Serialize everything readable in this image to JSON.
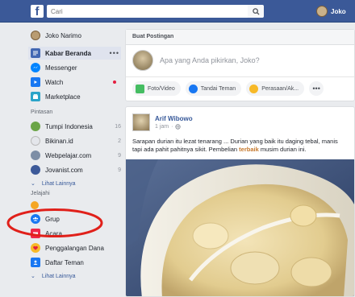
{
  "topbar": {
    "logo_letter": "f",
    "search_placeholder": "Cari",
    "user_name": "Joko"
  },
  "sidebar": {
    "profile": {
      "label": "Joko Narimo"
    },
    "main_items": [
      {
        "label": "Kabar Beranda",
        "icon": "news-feed-icon",
        "active": true
      },
      {
        "label": "Messenger",
        "icon": "messenger-icon"
      },
      {
        "label": "Watch",
        "icon": "watch-icon",
        "badge_dot": true
      },
      {
        "label": "Marketplace",
        "icon": "marketplace-icon"
      }
    ],
    "more_dots": "•••",
    "shortcuts_title": "Pintasan",
    "shortcuts": [
      {
        "label": "Tumpi Indonesia",
        "count": "16"
      },
      {
        "label": "Bikinan.id",
        "count": "2"
      },
      {
        "label": "Webpelajar.com",
        "count": "9"
      },
      {
        "label": "Jovanist.com",
        "count": "9"
      }
    ],
    "shortcuts_more": "Lihat Lainnya",
    "explore_title": "Jelajahi",
    "explore": [
      {
        "label": "Grup",
        "icon": "groups-icon"
      },
      {
        "label": "Acara",
        "icon": "events-icon"
      },
      {
        "label": "Penggalangan Dana",
        "icon": "fundraiser-icon"
      },
      {
        "label": "Daftar Teman",
        "icon": "friend-list-icon"
      }
    ],
    "explore_more": "Lihat Lainnya"
  },
  "composer": {
    "title": "Buat Postingan",
    "placeholder": "Apa yang Anda pikirkan, Joko?",
    "actions": [
      {
        "label": "Foto/Video",
        "color": "#45bd62"
      },
      {
        "label": "Tandai Teman",
        "color": "#1877f2"
      },
      {
        "label": "Perasaan/Ak...",
        "color": "#f7b928"
      }
    ],
    "more": "•••"
  },
  "post": {
    "author": "Arif Wibowo",
    "time": "1 jam",
    "text_line1": "Sarapan durian itu lezat tenarang ... Durian yang baik itu daging tebal, manis",
    "text_line2_prefix": "tapi ada pahit pahitnya sikit. Pembelian ",
    "text_highlight": "terbaik",
    "text_line2_suffix": " musim durian ini."
  },
  "colors": {
    "brand": "#3b5998",
    "link": "#365899",
    "annotation": "#e0201a"
  }
}
